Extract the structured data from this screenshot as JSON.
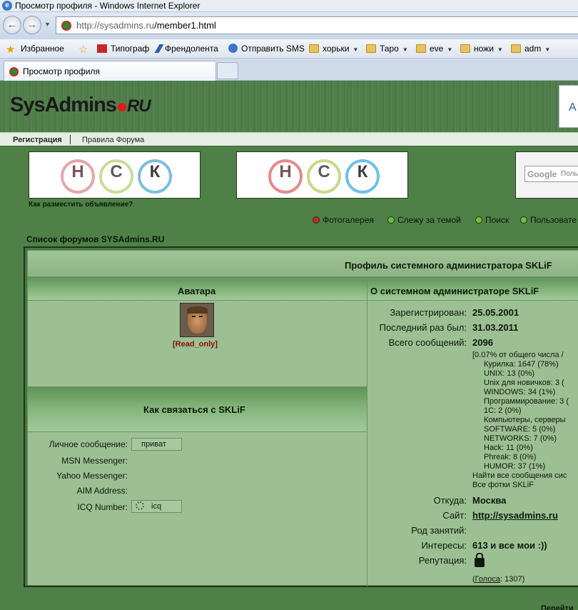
{
  "browser": {
    "window_title": "Просмотр профиля - Windows Internet Explorer",
    "url_host": "http://sysadmins.ru",
    "url_path": "/member1.html",
    "tab_title": "Просмотр профиля",
    "favorites": [
      {
        "label": "Избранное",
        "icon": "star-icon"
      },
      {
        "label": "Типограф",
        "icon": "typograf-icon"
      },
      {
        "label": "Френдолента",
        "icon": "pen-icon"
      },
      {
        "label": "Отправить SMS",
        "icon": "ie-icon"
      },
      {
        "label": "хорьки",
        "icon": "folder-icon"
      },
      {
        "label": "Таро",
        "icon": "folder-icon"
      },
      {
        "label": "eve",
        "icon": "folder-icon"
      },
      {
        "label": "ножи",
        "icon": "folder-icon"
      },
      {
        "label": "adm",
        "icon": "folder-icon"
      }
    ]
  },
  "site": {
    "logo_main": "SysAdmins",
    "logo_tld": "RU",
    "header_box_letter": "A",
    "menu": {
      "register": "Регистрация",
      "rules": "Правила Форума"
    },
    "banner_letters": [
      "Н",
      "С",
      "К"
    ],
    "place_ad": "Как разместить объявление?",
    "google": {
      "logo": "Google",
      "placeholder": "Поль"
    },
    "nav_links": [
      "Фотогалерея",
      "Слежу за темой",
      "Поиск",
      "Пользовате"
    ],
    "forum_list": "Список форумов SYSAdmins.RU"
  },
  "profile": {
    "title": "Профиль системного администратора SKLiF",
    "avatar_header": "Аватара",
    "about_header": "О системном администраторе SKLiF",
    "avatar_caption": "[Read_only]",
    "contact_header": "Как связаться с SKLiF",
    "contacts": {
      "pm_label": "Личное сообщение:",
      "pm_button": "приват",
      "msn_label": "MSN Messenger:",
      "yahoo_label": "Yahoo Messenger:",
      "aim_label": "AIM Address:",
      "icq_label": "ICQ Number:",
      "icq_button": "icq"
    },
    "about": {
      "registered_label": "Зарегистрирован:",
      "registered": "25.05.2001",
      "last_seen_label": "Последний раз был:",
      "last_seen": "31.03.2011",
      "posts_label": "Всего сообщений:",
      "posts": "2096",
      "posts_share": "[0.07% от общего числа /",
      "breakdown": [
        "Курилка: 1647 (78%)",
        "UNIX: 13 (0%)",
        "Unix для новичков: 3 (",
        "WINDOWS: 34 (1%)",
        "Программирование: 3 (",
        "1С: 2 (0%)",
        "Компьютеры, серверы",
        "SOFTWARE: 5 (0%)",
        "NETWORKS: 7 (0%)",
        "Hack: 11 (0%)",
        "Phreak: 8 (0%)",
        "HUMOR: 37 (1%)"
      ],
      "find_all": "Найти все сообщения сис",
      "all_photos": "Все фотки SKLiF",
      "from_label": "Откуда:",
      "from": "Москва",
      "site_label": "Сайт:",
      "site": "http://sysadmins.ru",
      "occupation_label": "Род занятий:",
      "interests_label": "Интересы:",
      "interests": "613 и все мои :))",
      "reputation_label": "Репутация:",
      "votes_prefix": "(",
      "votes_link": "Голоса",
      "votes_count": ": 1307)"
    }
  },
  "footer_cut": "Перейти"
}
